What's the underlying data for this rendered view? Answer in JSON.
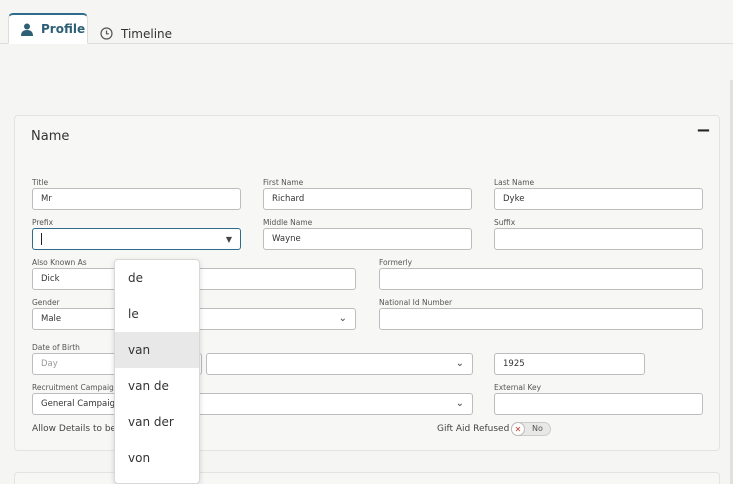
{
  "tabs": [
    {
      "label": "Profile",
      "icon": "person-icon",
      "active": true
    },
    {
      "label": "Timeline",
      "icon": "clock-icon",
      "active": false
    }
  ],
  "name_section": {
    "title": "Name",
    "collapse_symbol": "−",
    "fields": {
      "title": {
        "label": "Title",
        "value": "Mr"
      },
      "first_name": {
        "label": "First Name",
        "value": "Richard"
      },
      "last_name": {
        "label": "Last Name",
        "value": "Dyke"
      },
      "prefix": {
        "label": "Prefix",
        "value": ""
      },
      "middle_name": {
        "label": "Middle Name",
        "value": "Wayne"
      },
      "suffix": {
        "label": "Suffix",
        "value": ""
      },
      "also_known_as": {
        "label": "Also Known As",
        "value": "Dick"
      },
      "formerly": {
        "label": "Formerly",
        "value": ""
      },
      "gender": {
        "label": "Gender",
        "value": "Male"
      },
      "national_id": {
        "label": "National Id Number",
        "value": ""
      },
      "date_of_birth": {
        "label": "Date of Birth",
        "day_placeholder": "Day",
        "month_value": "",
        "year_value": "1925"
      },
      "recruitment_campaign": {
        "label": "Recruitment Campaign",
        "value": "General Campaign"
      },
      "external_key": {
        "label": "External Key",
        "value": ""
      }
    },
    "allow_details_label": "Allow Details to be",
    "gift_aid_label": "Gift Aid Refused",
    "gift_aid_toggle": {
      "state_text": "No",
      "icon": "x-icon"
    }
  },
  "prefix_dropdown": {
    "options": [
      "de",
      "le",
      "van",
      "van de",
      "van der",
      "von"
    ],
    "highlighted": "van"
  },
  "colors": {
    "accent": "#2f6b8a",
    "background": "#f5f5f3",
    "danger": "#c0392b"
  }
}
